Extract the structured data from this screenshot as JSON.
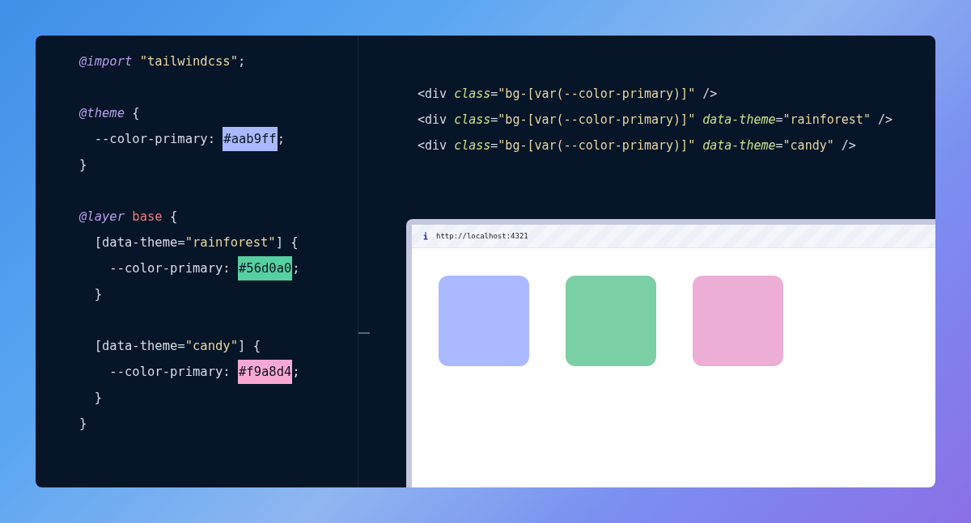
{
  "css_code": {
    "blocks": [
      {
        "lines": [
          {
            "tokens": [
              {
                "kind": "at",
                "text": "@import"
              },
              {
                "kind": "string",
                "text": " \"tailwindcss\""
              },
              {
                "kind": "plain",
                "text": ";"
              }
            ]
          }
        ]
      },
      {
        "lines": [
          {
            "tokens": [
              {
                "kind": "at",
                "text": "@theme"
              },
              {
                "kind": "plain",
                "text": " {"
              }
            ]
          },
          {
            "tokens": [
              {
                "kind": "plain",
                "text": "  --color-primary: "
              },
              {
                "kind": "swatch",
                "text": "#aab9ff",
                "color": "#aab9ff"
              },
              {
                "kind": "plain",
                "text": ";"
              }
            ]
          },
          {
            "tokens": [
              {
                "kind": "plain",
                "text": "}"
              }
            ]
          }
        ]
      },
      {
        "lines": [
          {
            "tokens": [
              {
                "kind": "at",
                "text": "@layer"
              },
              {
                "kind": "keyword",
                "text": " base"
              },
              {
                "kind": "plain",
                "text": " {"
              }
            ]
          },
          {
            "tokens": [
              {
                "kind": "plain",
                "text": "  [data-theme="
              },
              {
                "kind": "string",
                "text": "\"rainforest\""
              },
              {
                "kind": "plain",
                "text": "] {"
              }
            ]
          },
          {
            "tokens": [
              {
                "kind": "plain",
                "text": "    --color-primary: "
              },
              {
                "kind": "swatch",
                "text": "#56d0a0",
                "color": "#56d0a0"
              },
              {
                "kind": "plain",
                "text": ";"
              }
            ]
          },
          {
            "tokens": [
              {
                "kind": "plain",
                "text": "  }"
              }
            ]
          }
        ]
      },
      {
        "lines": [
          {
            "tokens": [
              {
                "kind": "plain",
                "text": "  [data-theme="
              },
              {
                "kind": "string",
                "text": "\"candy\""
              },
              {
                "kind": "plain",
                "text": "] {"
              }
            ]
          },
          {
            "tokens": [
              {
                "kind": "plain",
                "text": "    --color-primary: "
              },
              {
                "kind": "swatch",
                "text": "#f9a8d4",
                "color": "#f9a8d4"
              },
              {
                "kind": "plain",
                "text": ";"
              }
            ]
          },
          {
            "tokens": [
              {
                "kind": "plain",
                "text": "  }"
              }
            ]
          },
          {
            "tokens": [
              {
                "kind": "plain",
                "text": "}"
              }
            ]
          }
        ]
      }
    ]
  },
  "html_code": {
    "lines": [
      {
        "tokens": [
          {
            "kind": "plain",
            "text": "<div "
          },
          {
            "kind": "attr",
            "text": "class"
          },
          {
            "kind": "plain",
            "text": "="
          },
          {
            "kind": "string",
            "text": "\"bg-[var(--color-primary)]\""
          },
          {
            "kind": "plain",
            "text": " />"
          }
        ]
      },
      {
        "tokens": [
          {
            "kind": "plain",
            "text": "<div "
          },
          {
            "kind": "attr",
            "text": "class"
          },
          {
            "kind": "plain",
            "text": "="
          },
          {
            "kind": "string",
            "text": "\"bg-[var(--color-primary)]\""
          },
          {
            "kind": "attr",
            "text": " data-theme"
          },
          {
            "kind": "plain",
            "text": "="
          },
          {
            "kind": "string",
            "text": "\"rainforest\""
          },
          {
            "kind": "plain",
            "text": " />"
          }
        ]
      },
      {
        "tokens": [
          {
            "kind": "plain",
            "text": "<div "
          },
          {
            "kind": "attr",
            "text": "class"
          },
          {
            "kind": "plain",
            "text": "="
          },
          {
            "kind": "string",
            "text": "\"bg-[var(--color-primary)]\""
          },
          {
            "kind": "attr",
            "text": " data-theme"
          },
          {
            "kind": "plain",
            "text": "="
          },
          {
            "kind": "string",
            "text": "\"candy\""
          },
          {
            "kind": "plain",
            "text": " />"
          }
        ]
      }
    ]
  },
  "browser": {
    "url": "http://localhost:4321",
    "boxes": [
      {
        "color": "#aab9ff"
      },
      {
        "color": "#7acfa4"
      },
      {
        "color": "#edaed5"
      }
    ]
  }
}
